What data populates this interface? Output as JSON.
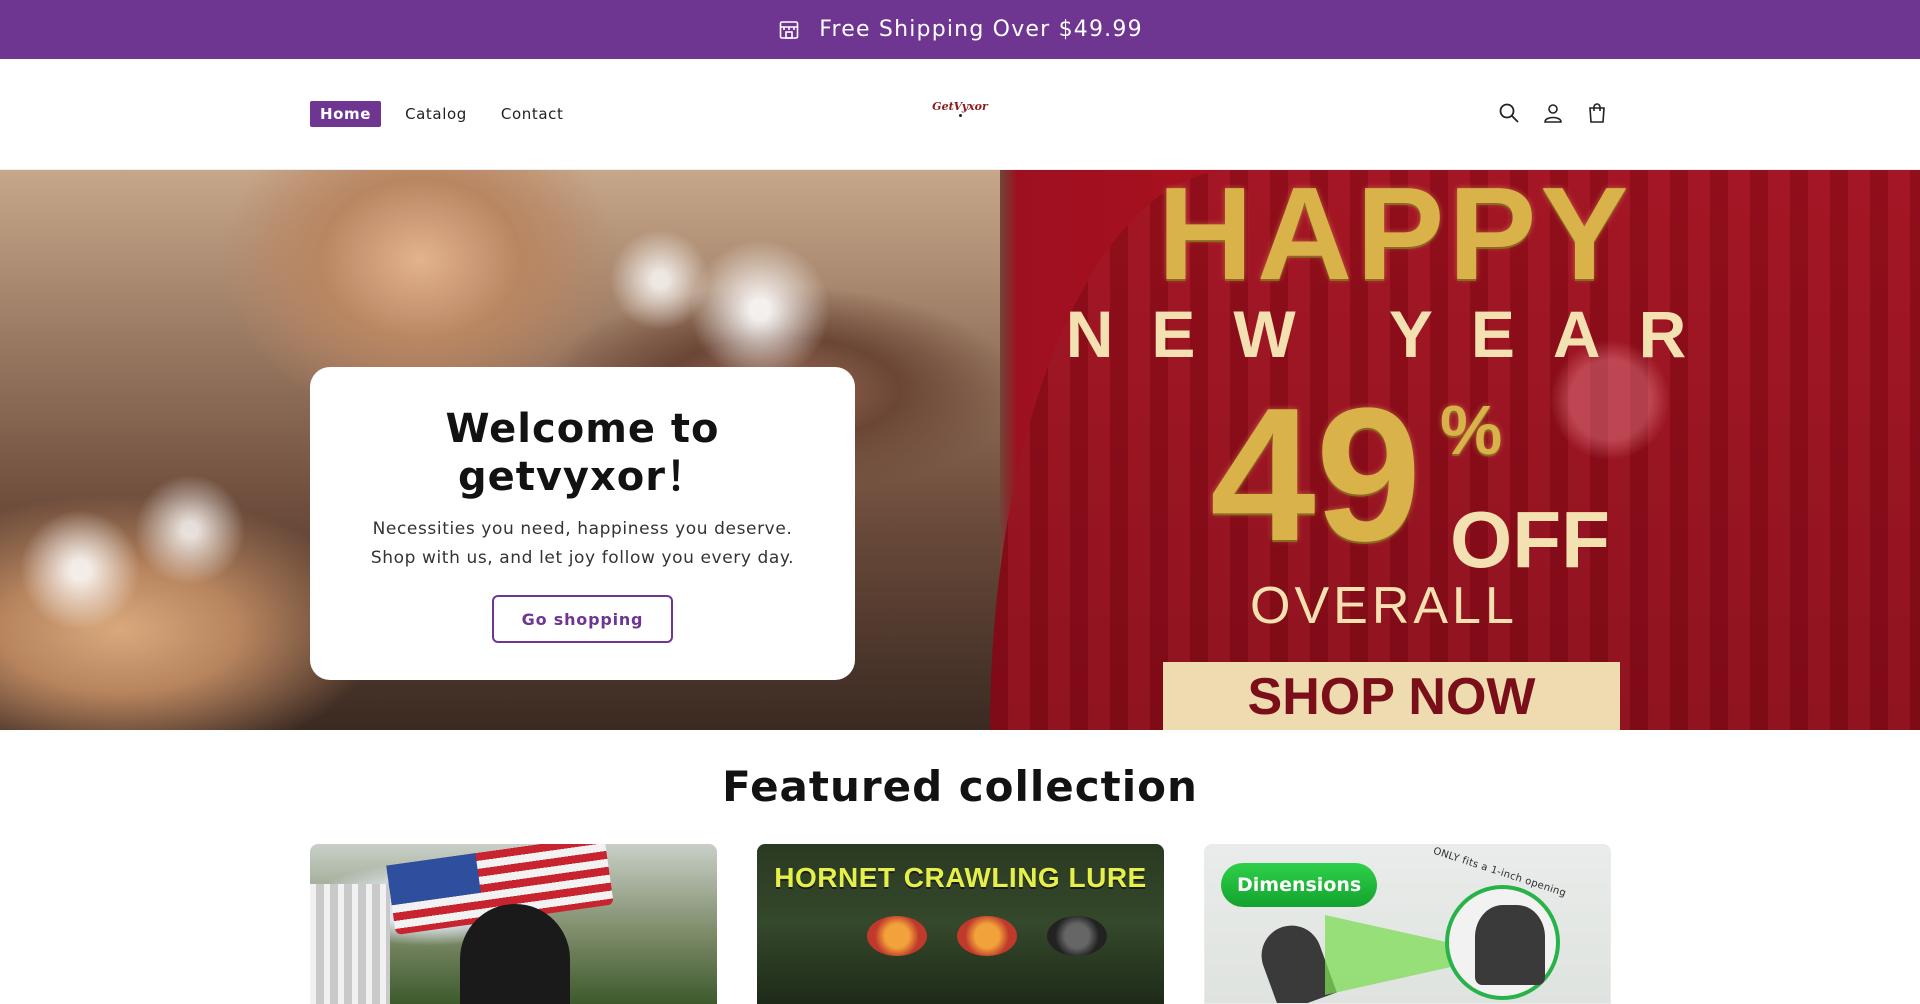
{
  "announcement": {
    "icon": "store-icon",
    "text": "Free Shipping Over $49.99",
    "background": "#6e3690"
  },
  "header": {
    "nav": [
      {
        "label": "Home",
        "active": true
      },
      {
        "label": "Catalog",
        "active": false
      },
      {
        "label": "Contact",
        "active": false
      }
    ],
    "logo_text": "GetVyxor",
    "icons": [
      "search-icon",
      "account-icon",
      "cart-icon"
    ]
  },
  "hero": {
    "card": {
      "title": "Welcome to getvyxor！",
      "subtitle": "Necessities you need, happiness you deserve. Shop with us, and let joy follow you every day.",
      "button_label": "Go shopping"
    },
    "banner": {
      "happy": "HAPPY",
      "new_year": "NEW YEAR",
      "discount_number": "49",
      "discount_percent": "%",
      "off": "OFF",
      "overall": "OVERALL",
      "shop_now": "SHOP NOW"
    }
  },
  "featured": {
    "title": "Featured collection",
    "products": [
      {
        "image_text": ""
      },
      {
        "image_text": "HORNET CRAWLING LURE"
      },
      {
        "image_text": "Dimensions",
        "image_caption": "ONLY fits a 1-inch opening"
      }
    ]
  },
  "colors": {
    "accent": "#6e3690",
    "banner_red": "#a10f1e",
    "gold": "#d9b24a"
  }
}
